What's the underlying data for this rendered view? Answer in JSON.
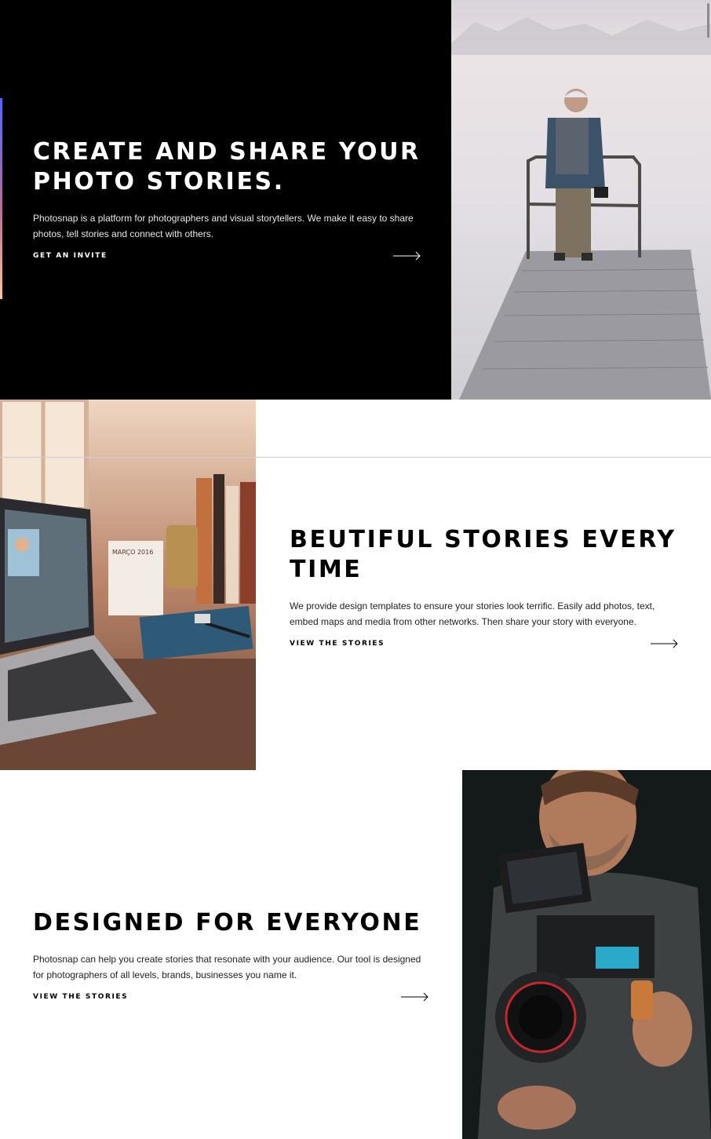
{
  "hero": {
    "title": "CREATE AND SHARE YOUR PHOTO STORIES.",
    "description": "Photosnap is a platform for photographers and visual storytellers. We make it easy to share photos, tell stories and connect with others.",
    "cta_label": "GET AN INVITE",
    "image_icon": "man-on-pier-photo"
  },
  "feature_1": {
    "title": "BEUTIFUL STORIES EVERY TIME",
    "description": "We provide design templates to ensure your stories look terrific. Easily add photos, text, embed maps and media from other networks. Then share your story with everyone.",
    "cta_label": "VIEW THE STORIES",
    "image_icon": "laptop-desk-photo",
    "calendar_label": "MARÇO 2016"
  },
  "feature_2": {
    "title": "DESIGNED FOR EVERYONE",
    "description": "Photosnap can help you create stories that resonate with your audience. Our tool is designed for photographers of all levels, brands, businesses you name it.",
    "cta_label": "VIEW THE STORIES",
    "image_icon": "camera-operator-photo"
  },
  "colors": {
    "hero_background": "#000000",
    "accent_gradient_start": "#5165ff",
    "accent_gradient_mid": "#bd6b9a",
    "accent_gradient_end": "#ffc593",
    "text_dark": "#000000",
    "text_light": "#ffffff"
  },
  "icons": {
    "cta_arrow": "arrow-right-icon"
  }
}
